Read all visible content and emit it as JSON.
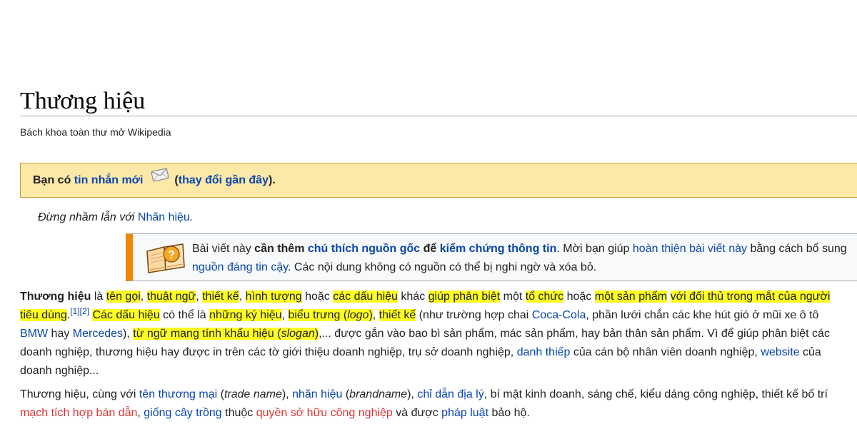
{
  "title": "Thương hiệu",
  "tagline": "Bách khoa toàn thư mở Wikipedia",
  "talk_message": {
    "prefix": "Bạn có",
    "link": "tin nhắn mới",
    "open_paren": "(",
    "recent_changes": "thay đổi gần đây",
    "close": ")."
  },
  "hatnote": {
    "text": "Đừng nhầm lẫn với",
    "link": "Nhãn hiệu",
    "end": "."
  },
  "ambox": {
    "t1": "Bài viết này",
    "t2": "cần thêm",
    "t3": "chú thích nguồn gốc",
    "t4": "để",
    "t5": "kiểm chứng thông tin",
    "t6": ". Mời bạn giúp",
    "t7": "hoàn thiện bài viết này",
    "t8": "bằng cách bổ sung",
    "t9": "nguồn đáng tin cậy",
    "t10": ". Các nội dung không có nguồn có thể bị nghi ngờ và xóa bỏ."
  },
  "para1": {
    "bold": "Thương hiệu",
    "s1": " là ",
    "l1": "tên gọi",
    "s2": ", ",
    "l2": "thuật ngữ",
    "s3": ", ",
    "l3": "thiết kế",
    "s4": ", ",
    "l4": "hình tượng",
    "s5": " hoặc ",
    "l5": "các dấu hiệu",
    "s6": " khác ",
    "l6": "giúp phân biệt",
    "s7": " một ",
    "l7": "tổ chức",
    "s8": " hoặc ",
    "l8": "một sản phẩm",
    "s9": " ",
    "l9": "với đối thủ trong mắt của người",
    "l10": "tiêu dùng",
    "s10": ".",
    "ref": "[1][2]",
    "s11": " ",
    "l11": "Các dấu hiệu",
    "s12": " có thể là ",
    "l12": "những ký hiệu",
    "s13": ", ",
    "l13a": "biểu trưng (",
    "l13b": "logo",
    "l13c": ")",
    "s14": ", ",
    "l14": "thiết kế",
    "s15": " (như trường hợp chai ",
    "link_coca": "Coca-Cola",
    "s16": ", phần lưới chắn các khe hút gió ở mũi xe ô tô",
    "link_bmw": "BMW",
    "s17": " hay ",
    "link_merc": "Mercedes",
    "s18": "), ",
    "l15a": "từ ngữ mang tính khẩu hiệu (",
    "l15b": "slogan",
    "l15c": ")",
    "s19": ",... được gắn vào bao bì sản phẩm, mác sản phẩm, hay bản thân sản phẩm. Vì để giúp phân biệt các",
    "line4": "doanh nghiệp, thương hiệu hay được in trên các tờ giới thiệu doanh nghiệp, trụ sở doanh nghiệp, ",
    "link_card": "danh thiếp",
    "s20": " của cán bộ nhân viên doanh nghiệp, ",
    "link_web": "website",
    "s21": " của",
    "line5": "doanh nghiệp..."
  },
  "para2": {
    "s1": "Thương hiệu, cùng với ",
    "l1": "tên thương mại",
    "s2": " (",
    "i1": "trade name",
    "s3": "), ",
    "l2": "nhãn hiệu",
    "s4": " (",
    "i2": "brandname",
    "s5": "), ",
    "l3": "chỉ dẫn địa lý",
    "s6": ", bí mật kinh doanh, sáng chế, kiểu dáng công nghiệp, thiết kế bố trí",
    "r1": "mạch tích hợp bán dẫn",
    "s7": ", ",
    "l4": "giống cây trồng",
    "s8": " thuộc ",
    "r2": "quyền sở hữu công nghiệp",
    "s9": " và được ",
    "l5": "pháp luật",
    "s10": " bảo hộ."
  }
}
